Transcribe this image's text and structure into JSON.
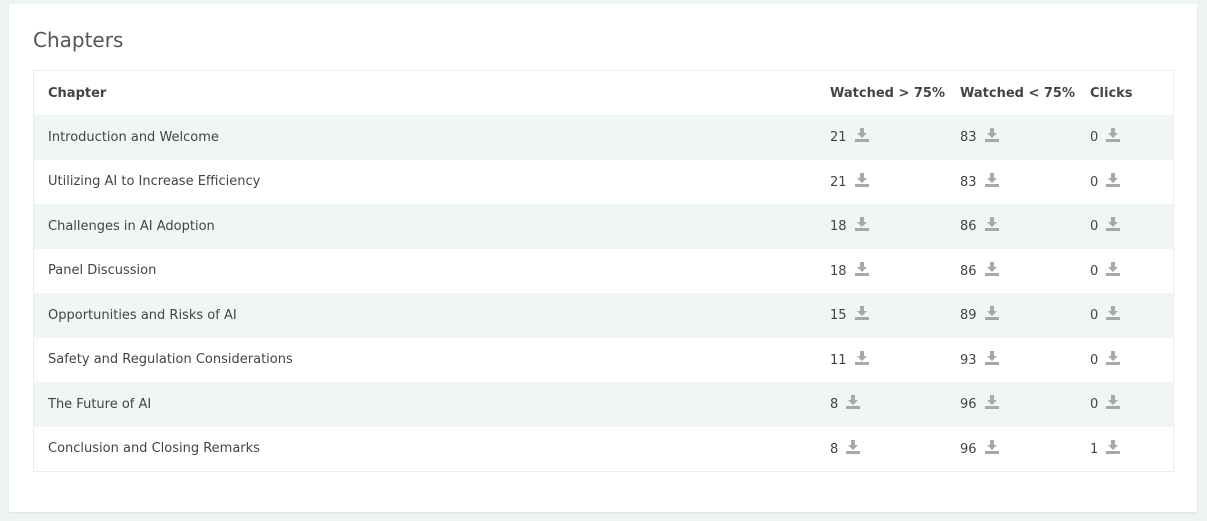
{
  "title": "Chapters",
  "table": {
    "headers": [
      "Chapter",
      "Watched > 75%",
      "Watched < 75%",
      "Clicks"
    ],
    "rows": [
      {
        "chapter": "Introduction and Welcome",
        "watched_over": "21",
        "watched_under": "83",
        "clicks": "0"
      },
      {
        "chapter": "Utilizing AI to Increase Efficiency",
        "watched_over": "21",
        "watched_under": "83",
        "clicks": "0"
      },
      {
        "chapter": "Challenges in AI Adoption",
        "watched_over": "18",
        "watched_under": "86",
        "clicks": "0"
      },
      {
        "chapter": "Panel Discussion",
        "watched_over": "18",
        "watched_under": "86",
        "clicks": "0"
      },
      {
        "chapter": "Opportunities and Risks of AI",
        "watched_over": "15",
        "watched_under": "89",
        "clicks": "0"
      },
      {
        "chapter": "Safety and Regulation Considerations",
        "watched_over": "11",
        "watched_under": "93",
        "clicks": "0"
      },
      {
        "chapter": "The Future of AI",
        "watched_over": "8",
        "watched_under": "96",
        "clicks": "0"
      },
      {
        "chapter": "Conclusion and Closing Remarks",
        "watched_over": "8",
        "watched_under": "96",
        "clicks": "1"
      }
    ]
  },
  "icons": {
    "download": "download-icon"
  },
  "colors": {
    "stripe": "#f0f5f5",
    "icon": "#a8a8a8",
    "background": "#eef4f4"
  }
}
